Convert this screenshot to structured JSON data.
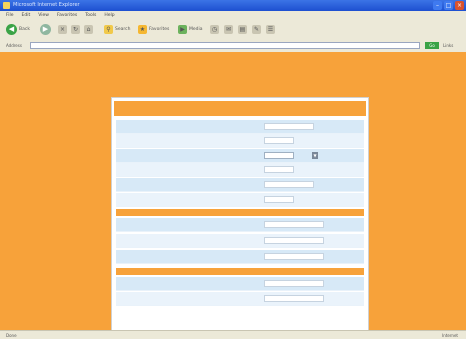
{
  "window": {
    "title": "Microsoft Internet Explorer",
    "minimize_glyph": "–",
    "maximize_glyph": "□",
    "close_glyph": "×"
  },
  "menu": [
    "File",
    "Edit",
    "View",
    "Favorites",
    "Tools",
    "Help"
  ],
  "toolbar": {
    "back_label": "Back",
    "search_label": "Search",
    "favorites_label": "Favorites",
    "media_label": "Media"
  },
  "address": {
    "label": "Address",
    "url": "",
    "go_label": "Go",
    "links_label": "Links"
  },
  "form": {
    "title": "",
    "subtitle": "",
    "rows_group1": [
      {
        "label": "",
        "field_type": "text"
      },
      {
        "label": "",
        "field_type": "text"
      },
      {
        "label": "",
        "field_type": "select",
        "value": ""
      },
      {
        "label": "",
        "field_type": "text"
      },
      {
        "label": "",
        "field_type": "text"
      },
      {
        "label": "",
        "field_type": "text"
      }
    ],
    "section2_title": "",
    "rows_group2": [
      {
        "label": ""
      },
      {
        "label": ""
      },
      {
        "label": ""
      }
    ],
    "section3_title": "",
    "rows_group3": [
      {
        "label": ""
      },
      {
        "label": ""
      }
    ]
  },
  "statusbar": {
    "left": "Done",
    "zone": "Internet"
  },
  "colors": {
    "page_background": "#f7a23a",
    "row_blue": "#d7e9f7",
    "titlebar": "#1d4fd0"
  }
}
